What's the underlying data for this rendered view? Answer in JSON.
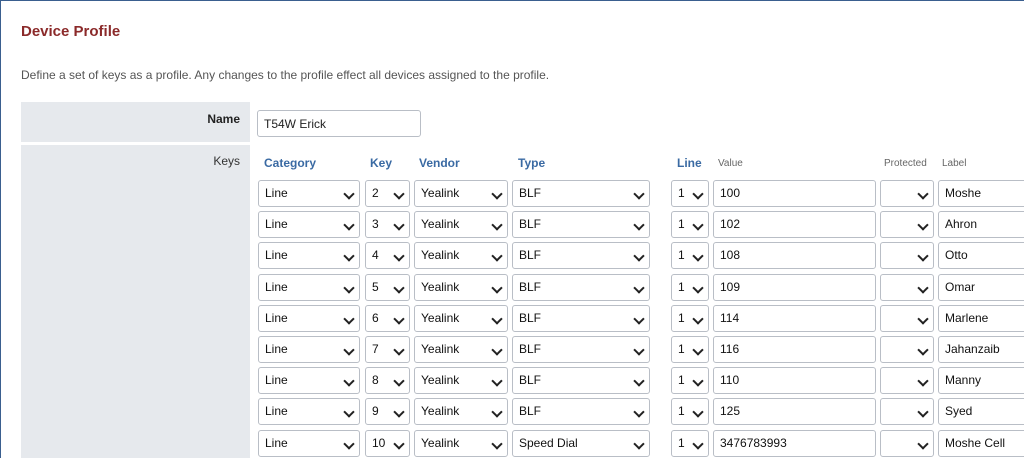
{
  "page": {
    "title": "Device Profile",
    "description": "Define a set of keys as a profile. Any changes to the profile effect all devices assigned to the profile."
  },
  "name_field": {
    "label": "Name",
    "value": "T54W Erick"
  },
  "keys": {
    "label": "Keys",
    "headers": {
      "category": "Category",
      "key": "Key",
      "vendor": "Vendor",
      "type": "Type",
      "line": "Line",
      "value": "Value",
      "protected": "Protected",
      "label": "Label"
    },
    "rows": [
      {
        "category": "Line",
        "key": "2",
        "vendor": "Yealink",
        "type": "BLF",
        "line": "1",
        "value": "100",
        "protected": "",
        "label": "Moshe"
      },
      {
        "category": "Line",
        "key": "3",
        "vendor": "Yealink",
        "type": "BLF",
        "line": "1",
        "value": "102",
        "protected": "",
        "label": "Ahron"
      },
      {
        "category": "Line",
        "key": "4",
        "vendor": "Yealink",
        "type": "BLF",
        "line": "1",
        "value": "108",
        "protected": "",
        "label": "Otto"
      },
      {
        "category": "Line",
        "key": "5",
        "vendor": "Yealink",
        "type": "BLF",
        "line": "1",
        "value": "109",
        "protected": "",
        "label": "Omar"
      },
      {
        "category": "Line",
        "key": "6",
        "vendor": "Yealink",
        "type": "BLF",
        "line": "1",
        "value": "114",
        "protected": "",
        "label": "Marlene"
      },
      {
        "category": "Line",
        "key": "7",
        "vendor": "Yealink",
        "type": "BLF",
        "line": "1",
        "value": "116",
        "protected": "",
        "label": "Jahanzaib"
      },
      {
        "category": "Line",
        "key": "8",
        "vendor": "Yealink",
        "type": "BLF",
        "line": "1",
        "value": "110",
        "protected": "",
        "label": "Manny"
      },
      {
        "category": "Line",
        "key": "9",
        "vendor": "Yealink",
        "type": "BLF",
        "line": "1",
        "value": "125",
        "protected": "",
        "label": "Syed"
      },
      {
        "category": "Line",
        "key": "10",
        "vendor": "Yealink",
        "type": "Speed Dial",
        "line": "1",
        "value": "3476783993",
        "protected": "",
        "label": "Moshe Cell"
      }
    ]
  },
  "colors": {
    "title": "#8b2a2a",
    "header": "#3a6aa3",
    "label_bg": "#e6e9ed"
  }
}
